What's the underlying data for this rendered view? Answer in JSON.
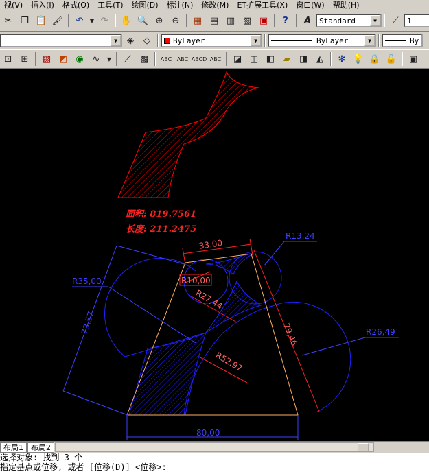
{
  "menu": [
    "视(V)",
    "插入(I)",
    "格式(O)",
    "工具(T)",
    "绘图(D)",
    "标注(N)",
    "修改(M)",
    "ET扩展工具(X)",
    "窗口(W)",
    "帮助(H)"
  ],
  "toolbar": {
    "text_style": "Standard",
    "dim_scale": "1",
    "color": "ByLayer",
    "linetype": "ByLayer",
    "lineweight": "By"
  },
  "drawing": {
    "area_label": "面积: 819.7561",
    "length_label": "长度: 211.2475",
    "dim_top": "33,00",
    "dim_bottom": "80,00",
    "dim_left": "73,57",
    "dim_right": "79,46",
    "r_small": "R10,00",
    "r_top": "R13,24",
    "r_left": "R35,00",
    "r_mid": "R27,44",
    "r_right": "R26,49",
    "r_bottom": "R52,97"
  },
  "tabs": [
    "布局1",
    "布局2"
  ],
  "command": {
    "line1": "选择对象: 找到 3 个",
    "line2": "指定基点或位移, 或者 [位移(D)] <位移>:"
  },
  "colors": {
    "canvas": "#000000",
    "red": "#ff0000",
    "blue": "#2020ff",
    "orange": "#ffb060"
  },
  "icons": [
    "cut-icon",
    "copy-icon",
    "paste-icon",
    "match-icon",
    "undo-icon",
    "redo-icon",
    "pan-icon",
    "zoom-icon",
    "zoom-window-icon",
    "zoom-prev-icon",
    "properties-icon",
    "design-center-icon",
    "tool-palette-icon",
    "markup-icon",
    "calculator-icon",
    "help-icon",
    "text-style-icon",
    "dim-style-icon"
  ]
}
